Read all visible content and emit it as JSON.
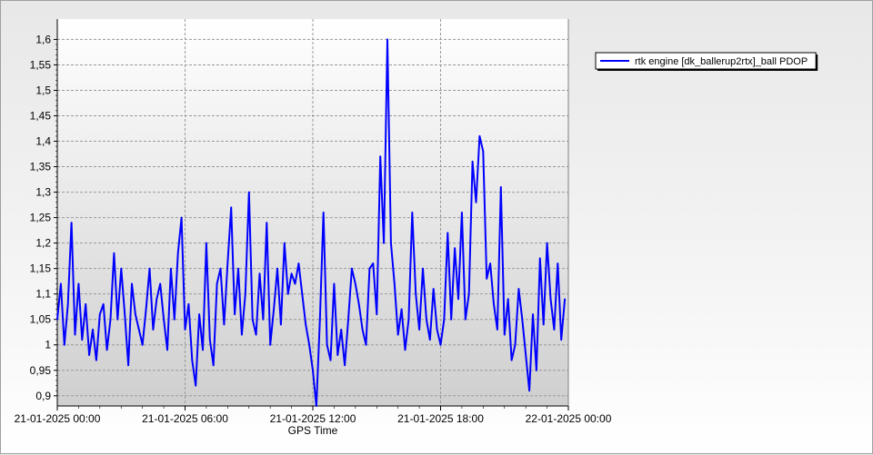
{
  "chart_data": {
    "type": "line",
    "title": "",
    "xlabel": "GPS Time",
    "ylabel": "",
    "xlim": [
      "21-01-2025 00:00",
      "22-01-2025 00:00"
    ],
    "ylim": [
      0.88,
      1.64
    ],
    "x_ticks": [
      "21-01-2025 00:00",
      "21-01-2025 06:00",
      "21-01-2025 12:00",
      "21-01-2025 18:00",
      "22-01-2025 00:00"
    ],
    "y_ticks": [
      "0,9",
      "0,95",
      "1",
      "1,05",
      "1,1",
      "1,15",
      "1,2",
      "1,25",
      "1,3",
      "1,35",
      "1,4",
      "1,45",
      "1,5",
      "1,55",
      "1,6"
    ],
    "grid": true,
    "legend": "top-right",
    "colors": {
      "series": "#0000ff",
      "grid": "#9a9a9a",
      "plot_bg_top": "#ffffff",
      "plot_bg_bottom": "#cfcfcf"
    },
    "series": [
      {
        "name": "rtk engine [dk_ballerup2rtx]_ball PDOP",
        "x": [
          "21-01-2025 00:00",
          "21-01-2025 00:10",
          "21-01-2025 00:20",
          "21-01-2025 00:30",
          "21-01-2025 00:40",
          "21-01-2025 00:50",
          "21-01-2025 01:00",
          "21-01-2025 01:10",
          "21-01-2025 01:20",
          "21-01-2025 01:30",
          "21-01-2025 01:40",
          "21-01-2025 01:50",
          "21-01-2025 02:00",
          "21-01-2025 02:10",
          "21-01-2025 02:20",
          "21-01-2025 02:30",
          "21-01-2025 02:40",
          "21-01-2025 02:50",
          "21-01-2025 03:00",
          "21-01-2025 03:10",
          "21-01-2025 03:20",
          "21-01-2025 03:30",
          "21-01-2025 03:40",
          "21-01-2025 03:50",
          "21-01-2025 04:00",
          "21-01-2025 04:10",
          "21-01-2025 04:20",
          "21-01-2025 04:30",
          "21-01-2025 04:40",
          "21-01-2025 04:50",
          "21-01-2025 05:00",
          "21-01-2025 05:10",
          "21-01-2025 05:20",
          "21-01-2025 05:30",
          "21-01-2025 05:40",
          "21-01-2025 05:50",
          "21-01-2025 06:00",
          "21-01-2025 06:10",
          "21-01-2025 06:20",
          "21-01-2025 06:30",
          "21-01-2025 06:40",
          "21-01-2025 06:50",
          "21-01-2025 07:00",
          "21-01-2025 07:10",
          "21-01-2025 07:20",
          "21-01-2025 07:30",
          "21-01-2025 07:40",
          "21-01-2025 07:50",
          "21-01-2025 08:00",
          "21-01-2025 08:10",
          "21-01-2025 08:20",
          "21-01-2025 08:30",
          "21-01-2025 08:40",
          "21-01-2025 08:50",
          "21-01-2025 09:00",
          "21-01-2025 09:10",
          "21-01-2025 09:20",
          "21-01-2025 09:30",
          "21-01-2025 09:40",
          "21-01-2025 09:50",
          "21-01-2025 10:00",
          "21-01-2025 10:10",
          "21-01-2025 10:20",
          "21-01-2025 10:30",
          "21-01-2025 10:40",
          "21-01-2025 10:50",
          "21-01-2025 11:00",
          "21-01-2025 11:10",
          "21-01-2025 11:20",
          "21-01-2025 11:30",
          "21-01-2025 11:40",
          "21-01-2025 11:50",
          "21-01-2025 12:00",
          "21-01-2025 12:10",
          "21-01-2025 12:20",
          "21-01-2025 12:30",
          "21-01-2025 12:40",
          "21-01-2025 12:50",
          "21-01-2025 13:00",
          "21-01-2025 13:10",
          "21-01-2025 13:20",
          "21-01-2025 13:30",
          "21-01-2025 13:40",
          "21-01-2025 13:50",
          "21-01-2025 14:00",
          "21-01-2025 14:10",
          "21-01-2025 14:20",
          "21-01-2025 14:30",
          "21-01-2025 14:40",
          "21-01-2025 14:50",
          "21-01-2025 15:00",
          "21-01-2025 15:10",
          "21-01-2025 15:20",
          "21-01-2025 15:30",
          "21-01-2025 15:40",
          "21-01-2025 15:50",
          "21-01-2025 16:00",
          "21-01-2025 16:10",
          "21-01-2025 16:20",
          "21-01-2025 16:30",
          "21-01-2025 16:40",
          "21-01-2025 16:50",
          "21-01-2025 17:00",
          "21-01-2025 17:10",
          "21-01-2025 17:20",
          "21-01-2025 17:30",
          "21-01-2025 17:40",
          "21-01-2025 17:50",
          "21-01-2025 18:00",
          "21-01-2025 18:10",
          "21-01-2025 18:20",
          "21-01-2025 18:30",
          "21-01-2025 18:40",
          "21-01-2025 18:50",
          "21-01-2025 19:00",
          "21-01-2025 19:10",
          "21-01-2025 19:20",
          "21-01-2025 19:30",
          "21-01-2025 19:40",
          "21-01-2025 19:50",
          "21-01-2025 20:00",
          "21-01-2025 20:10",
          "21-01-2025 20:20",
          "21-01-2025 20:30",
          "21-01-2025 20:40",
          "21-01-2025 20:50",
          "21-01-2025 21:00",
          "21-01-2025 21:10",
          "21-01-2025 21:20",
          "21-01-2025 21:30",
          "21-01-2025 21:40",
          "21-01-2025 21:50",
          "21-01-2025 22:00",
          "21-01-2025 22:10",
          "21-01-2025 22:20",
          "21-01-2025 22:30",
          "21-01-2025 22:40",
          "21-01-2025 22:50",
          "21-01-2025 23:00",
          "21-01-2025 23:10",
          "21-01-2025 23:20",
          "21-01-2025 23:30",
          "21-01-2025 23:40",
          "21-01-2025 23:50"
        ],
        "values": [
          1.05,
          1.12,
          1.0,
          1.08,
          1.24,
          1.02,
          1.12,
          1.01,
          1.08,
          0.98,
          1.03,
          0.97,
          1.06,
          1.08,
          0.99,
          1.05,
          1.18,
          1.05,
          1.15,
          1.06,
          0.96,
          1.12,
          1.06,
          1.03,
          1.0,
          1.07,
          1.15,
          1.03,
          1.09,
          1.12,
          1.05,
          0.99,
          1.15,
          1.05,
          1.18,
          1.25,
          1.03,
          1.08,
          0.97,
          0.92,
          1.06,
          0.99,
          1.2,
          1.01,
          0.96,
          1.12,
          1.15,
          1.04,
          1.16,
          1.27,
          1.06,
          1.15,
          1.02,
          1.1,
          1.3,
          1.05,
          1.02,
          1.14,
          1.05,
          1.24,
          1.0,
          1.07,
          1.15,
          1.04,
          1.2,
          1.1,
          1.14,
          1.12,
          1.16,
          1.1,
          1.04,
          1.0,
          0.95,
          0.88,
          1.05,
          1.26,
          1.0,
          0.97,
          1.12,
          0.98,
          1.03,
          0.96,
          1.05,
          1.15,
          1.12,
          1.08,
          1.03,
          1.0,
          1.15,
          1.16,
          1.06,
          1.37,
          1.2,
          1.6,
          1.2,
          1.12,
          1.02,
          1.07,
          0.99,
          1.05,
          1.26,
          1.1,
          1.03,
          1.15,
          1.05,
          1.01,
          1.11,
          1.03,
          1.0,
          1.05,
          1.22,
          1.05,
          1.19,
          1.09,
          1.26,
          1.05,
          1.1,
          1.36,
          1.28,
          1.41,
          1.38,
          1.13,
          1.16,
          1.08,
          1.03,
          1.31,
          1.02,
          1.09,
          0.97,
          1.0,
          1.11,
          1.05,
          0.98,
          0.91,
          1.06,
          0.95,
          1.17,
          1.04,
          1.2,
          1.09,
          1.03,
          1.16,
          1.01,
          1.09
        ]
      }
    ]
  }
}
